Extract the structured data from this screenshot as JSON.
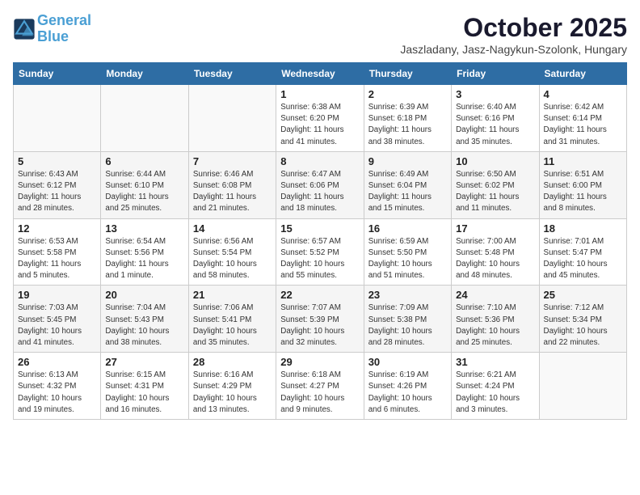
{
  "header": {
    "logo_line1": "General",
    "logo_line2": "Blue",
    "month": "October 2025",
    "location": "Jaszladany, Jasz-Nagykun-Szolonk, Hungary"
  },
  "weekdays": [
    "Sunday",
    "Monday",
    "Tuesday",
    "Wednesday",
    "Thursday",
    "Friday",
    "Saturday"
  ],
  "weeks": [
    [
      {
        "day": "",
        "info": ""
      },
      {
        "day": "",
        "info": ""
      },
      {
        "day": "",
        "info": ""
      },
      {
        "day": "1",
        "info": "Sunrise: 6:38 AM\nSunset: 6:20 PM\nDaylight: 11 hours\nand 41 minutes."
      },
      {
        "day": "2",
        "info": "Sunrise: 6:39 AM\nSunset: 6:18 PM\nDaylight: 11 hours\nand 38 minutes."
      },
      {
        "day": "3",
        "info": "Sunrise: 6:40 AM\nSunset: 6:16 PM\nDaylight: 11 hours\nand 35 minutes."
      },
      {
        "day": "4",
        "info": "Sunrise: 6:42 AM\nSunset: 6:14 PM\nDaylight: 11 hours\nand 31 minutes."
      }
    ],
    [
      {
        "day": "5",
        "info": "Sunrise: 6:43 AM\nSunset: 6:12 PM\nDaylight: 11 hours\nand 28 minutes."
      },
      {
        "day": "6",
        "info": "Sunrise: 6:44 AM\nSunset: 6:10 PM\nDaylight: 11 hours\nand 25 minutes."
      },
      {
        "day": "7",
        "info": "Sunrise: 6:46 AM\nSunset: 6:08 PM\nDaylight: 11 hours\nand 21 minutes."
      },
      {
        "day": "8",
        "info": "Sunrise: 6:47 AM\nSunset: 6:06 PM\nDaylight: 11 hours\nand 18 minutes."
      },
      {
        "day": "9",
        "info": "Sunrise: 6:49 AM\nSunset: 6:04 PM\nDaylight: 11 hours\nand 15 minutes."
      },
      {
        "day": "10",
        "info": "Sunrise: 6:50 AM\nSunset: 6:02 PM\nDaylight: 11 hours\nand 11 minutes."
      },
      {
        "day": "11",
        "info": "Sunrise: 6:51 AM\nSunset: 6:00 PM\nDaylight: 11 hours\nand 8 minutes."
      }
    ],
    [
      {
        "day": "12",
        "info": "Sunrise: 6:53 AM\nSunset: 5:58 PM\nDaylight: 11 hours\nand 5 minutes."
      },
      {
        "day": "13",
        "info": "Sunrise: 6:54 AM\nSunset: 5:56 PM\nDaylight: 11 hours\nand 1 minute."
      },
      {
        "day": "14",
        "info": "Sunrise: 6:56 AM\nSunset: 5:54 PM\nDaylight: 10 hours\nand 58 minutes."
      },
      {
        "day": "15",
        "info": "Sunrise: 6:57 AM\nSunset: 5:52 PM\nDaylight: 10 hours\nand 55 minutes."
      },
      {
        "day": "16",
        "info": "Sunrise: 6:59 AM\nSunset: 5:50 PM\nDaylight: 10 hours\nand 51 minutes."
      },
      {
        "day": "17",
        "info": "Sunrise: 7:00 AM\nSunset: 5:48 PM\nDaylight: 10 hours\nand 48 minutes."
      },
      {
        "day": "18",
        "info": "Sunrise: 7:01 AM\nSunset: 5:47 PM\nDaylight: 10 hours\nand 45 minutes."
      }
    ],
    [
      {
        "day": "19",
        "info": "Sunrise: 7:03 AM\nSunset: 5:45 PM\nDaylight: 10 hours\nand 41 minutes."
      },
      {
        "day": "20",
        "info": "Sunrise: 7:04 AM\nSunset: 5:43 PM\nDaylight: 10 hours\nand 38 minutes."
      },
      {
        "day": "21",
        "info": "Sunrise: 7:06 AM\nSunset: 5:41 PM\nDaylight: 10 hours\nand 35 minutes."
      },
      {
        "day": "22",
        "info": "Sunrise: 7:07 AM\nSunset: 5:39 PM\nDaylight: 10 hours\nand 32 minutes."
      },
      {
        "day": "23",
        "info": "Sunrise: 7:09 AM\nSunset: 5:38 PM\nDaylight: 10 hours\nand 28 minutes."
      },
      {
        "day": "24",
        "info": "Sunrise: 7:10 AM\nSunset: 5:36 PM\nDaylight: 10 hours\nand 25 minutes."
      },
      {
        "day": "25",
        "info": "Sunrise: 7:12 AM\nSunset: 5:34 PM\nDaylight: 10 hours\nand 22 minutes."
      }
    ],
    [
      {
        "day": "26",
        "info": "Sunrise: 6:13 AM\nSunset: 4:32 PM\nDaylight: 10 hours\nand 19 minutes."
      },
      {
        "day": "27",
        "info": "Sunrise: 6:15 AM\nSunset: 4:31 PM\nDaylight: 10 hours\nand 16 minutes."
      },
      {
        "day": "28",
        "info": "Sunrise: 6:16 AM\nSunset: 4:29 PM\nDaylight: 10 hours\nand 13 minutes."
      },
      {
        "day": "29",
        "info": "Sunrise: 6:18 AM\nSunset: 4:27 PM\nDaylight: 10 hours\nand 9 minutes."
      },
      {
        "day": "30",
        "info": "Sunrise: 6:19 AM\nSunset: 4:26 PM\nDaylight: 10 hours\nand 6 minutes."
      },
      {
        "day": "31",
        "info": "Sunrise: 6:21 AM\nSunset: 4:24 PM\nDaylight: 10 hours\nand 3 minutes."
      },
      {
        "day": "",
        "info": ""
      }
    ]
  ]
}
